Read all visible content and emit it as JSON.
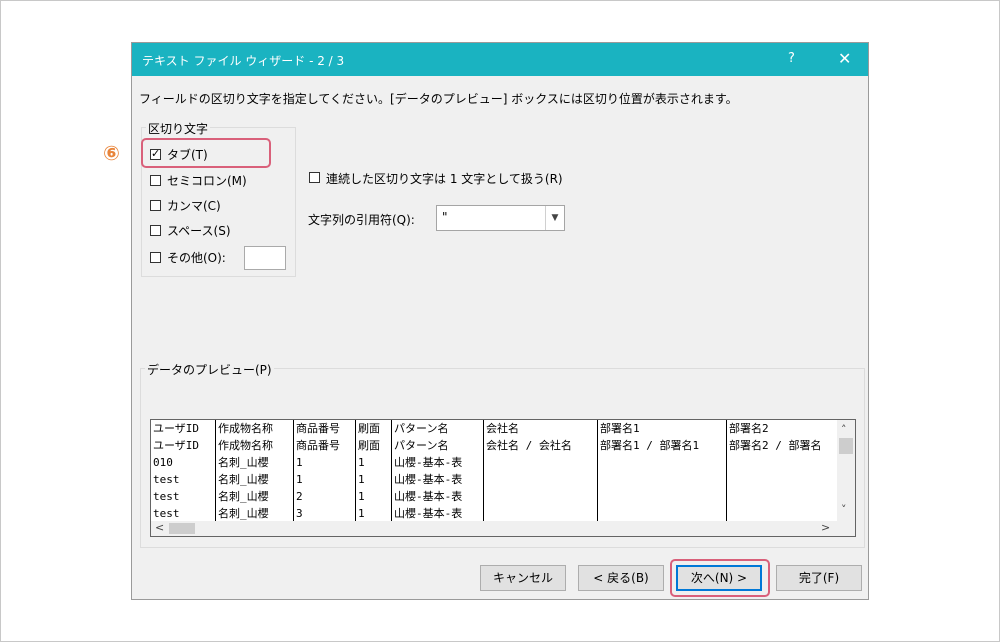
{
  "dialog": {
    "title": "テキスト ファイル ウィザード - 2 / 3",
    "help_label": "?",
    "close_label": "✕",
    "instruction": "フィールドの区切り文字を指定してください。[データのプレビュー] ボックスには区切り位置が表示されます。"
  },
  "delimiters": {
    "group_label": "区切り文字",
    "options": [
      {
        "label": "タブ(T)",
        "checked": true
      },
      {
        "label": "セミコロン(M)",
        "checked": false
      },
      {
        "label": "カンマ(C)",
        "checked": false
      },
      {
        "label": "スペース(S)",
        "checked": false
      },
      {
        "label": "その他(O):",
        "checked": false
      }
    ],
    "other_value": "",
    "consecutive_label": "連続した区切り文字は 1 文字として扱う(R)",
    "quote_label": "文字列の引用符(Q):",
    "quote_value": "\""
  },
  "step_marker": "⑥",
  "preview": {
    "label": "データのプレビュー(P)",
    "columns": [
      [
        "ユーザID",
        "ユーザID",
        "010",
        "test",
        "test",
        "test"
      ],
      [
        "作成物名称",
        "作成物名称",
        "名刺_山櫻",
        "名刺_山櫻",
        "名刺_山櫻",
        "名刺_山櫻"
      ],
      [
        "商品番号",
        "商品番号",
        "1",
        "1",
        "2",
        "3"
      ],
      [
        "刷面",
        "刷面",
        "1",
        "1",
        "1",
        "1"
      ],
      [
        "パターン名",
        "パターン名",
        "山櫻-基本-表",
        "山櫻-基本-表",
        "山櫻-基本-表",
        "山櫻-基本-表"
      ],
      [
        "会社名",
        "会社名 / 会社名",
        "",
        "",
        "",
        ""
      ],
      [
        "部署名1",
        "部署名1 / 部署名1",
        "",
        "",
        "",
        ""
      ],
      [
        "部署名2",
        "部署名2 / 部署名",
        "",
        "",
        "",
        ""
      ]
    ],
    "scroll_up": "˄",
    "scroll_down": "˅",
    "scroll_left": "<",
    "scroll_right": ">"
  },
  "buttons": {
    "cancel": "キャンセル",
    "back": "< 戻る(B)",
    "next": "次へ(N) >",
    "finish": "完了(F)"
  },
  "colors": {
    "titlebar": "#1ab3c1",
    "highlight": "#d9607a",
    "step_marker": "#e8843a"
  }
}
